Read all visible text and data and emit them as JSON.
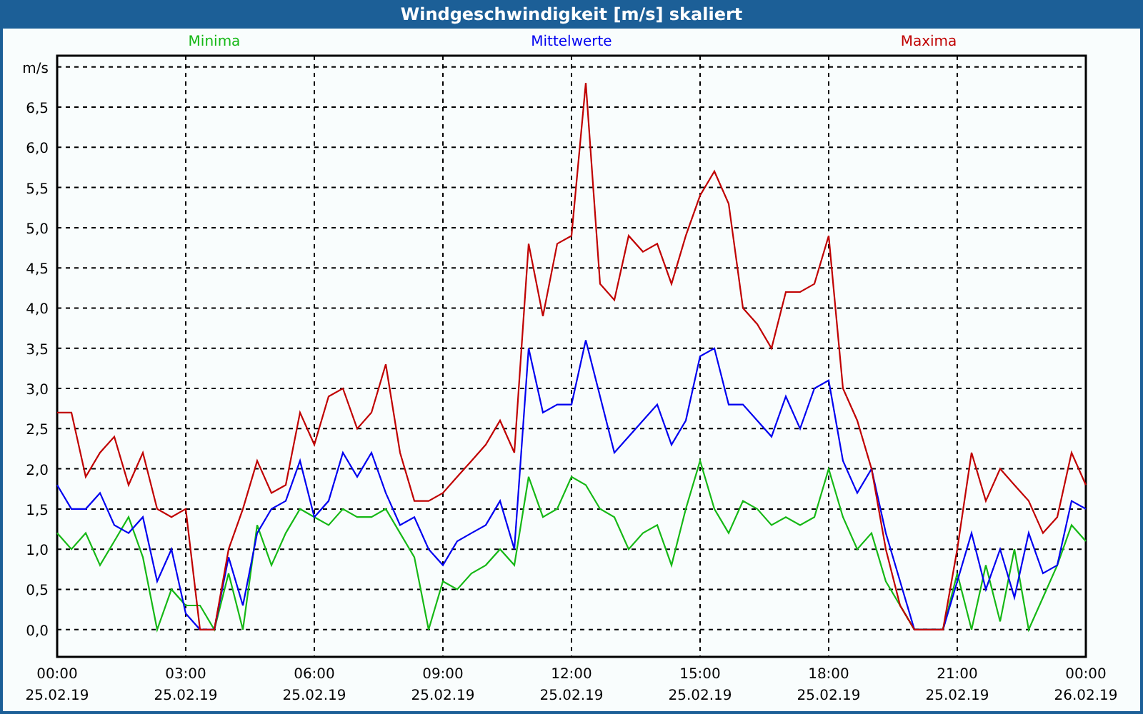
{
  "window": {
    "title": "Windgeschwindigkeit [m/s] skaliert"
  },
  "chart": {
    "chart_data": {
      "type": "line",
      "categories": [
        "00:00\n25.02.19",
        null,
        null,
        null,
        null,
        null,
        null,
        null,
        null,
        "03:00\n25.02.19",
        null,
        null,
        null,
        null,
        null,
        null,
        null,
        null,
        "06:00\n25.02.19",
        null,
        null,
        null,
        null,
        null,
        null,
        null,
        null,
        "09:00\n25.02.19",
        null,
        null,
        null,
        null,
        null,
        null,
        null,
        null,
        "12:00\n25.02.19",
        null,
        null,
        null,
        null,
        null,
        null,
        null,
        null,
        "15:00\n25.02.19",
        null,
        null,
        null,
        null,
        null,
        null,
        null,
        null,
        "18:00\n25.02.19",
        null,
        null,
        null,
        null,
        null,
        null,
        null,
        null,
        "21:00\n25.02.19",
        null,
        null,
        null,
        null,
        null,
        null,
        null,
        null,
        "00:00\n26.02.19"
      ],
      "series": [
        {
          "name": "Minima",
          "color": "#16b816",
          "values": [
            1.2,
            1.0,
            1.2,
            0.8,
            1.1,
            1.4,
            0.9,
            0.0,
            0.5,
            0.3,
            0.3,
            0.0,
            0.7,
            0.0,
            1.3,
            0.8,
            1.2,
            1.5,
            1.4,
            1.3,
            1.5,
            1.4,
            1.4,
            1.5,
            1.2,
            0.9,
            0.0,
            0.6,
            0.5,
            0.7,
            0.8,
            1.0,
            0.8,
            1.9,
            1.4,
            1.5,
            1.9,
            1.8,
            1.5,
            1.4,
            1.0,
            1.2,
            1.3,
            0.8,
            1.5,
            2.1,
            1.5,
            1.2,
            1.6,
            1.5,
            1.3,
            1.4,
            1.3,
            1.4,
            2.0,
            1.4,
            1.0,
            1.2,
            0.6,
            0.3,
            0.0,
            0.0,
            0.0,
            0.7,
            0.0,
            0.8,
            0.1,
            1.0,
            0.0,
            0.4,
            0.8,
            1.3,
            1.1
          ]
        },
        {
          "name": "Mittelwerte",
          "color": "#0000f0",
          "values": [
            1.8,
            1.5,
            1.5,
            1.7,
            1.3,
            1.2,
            1.4,
            0.6,
            1.0,
            0.2,
            0.0,
            0.0,
            0.9,
            0.3,
            1.2,
            1.5,
            1.6,
            2.1,
            1.4,
            1.6,
            2.2,
            1.9,
            2.2,
            1.7,
            1.3,
            1.4,
            1.0,
            0.8,
            1.1,
            1.2,
            1.3,
            1.6,
            1.0,
            3.5,
            2.7,
            2.8,
            2.8,
            3.6,
            2.9,
            2.2,
            2.4,
            2.6,
            2.8,
            2.3,
            2.6,
            3.4,
            3.5,
            2.8,
            2.8,
            2.6,
            2.4,
            2.9,
            2.5,
            3.0,
            3.1,
            2.1,
            1.7,
            2.0,
            1.2,
            0.6,
            0.0,
            0.0,
            0.0,
            0.6,
            1.2,
            0.5,
            1.0,
            0.4,
            1.2,
            0.7,
            0.8,
            1.6,
            1.5
          ]
        },
        {
          "name": "Maxima",
          "color": "#c00000",
          "values": [
            2.7,
            2.7,
            1.9,
            2.2,
            2.4,
            1.8,
            2.2,
            1.5,
            1.4,
            1.5,
            0.0,
            0.0,
            1.0,
            1.5,
            2.1,
            1.7,
            1.8,
            2.7,
            2.3,
            2.9,
            3.0,
            2.5,
            2.7,
            3.3,
            2.2,
            1.6,
            1.6,
            1.7,
            1.9,
            2.1,
            2.3,
            2.6,
            2.2,
            4.8,
            3.9,
            4.8,
            4.9,
            6.8,
            4.3,
            4.1,
            4.9,
            4.7,
            4.8,
            4.3,
            4.9,
            5.4,
            5.7,
            5.3,
            4.0,
            3.8,
            3.5,
            4.2,
            4.2,
            4.3,
            4.9,
            3.0,
            2.6,
            2.0,
            1.0,
            0.3,
            0.0,
            0.0,
            0.0,
            1.0,
            2.2,
            1.6,
            2.0,
            1.8,
            1.6,
            1.2,
            1.4,
            2.2,
            1.8
          ]
        }
      ],
      "ylim": [
        -0.34,
        7.14
      ],
      "grid": true,
      "yticks": [
        {
          "value": 0,
          "label": "0,0"
        },
        {
          "value": 0.5,
          "label": "0,5"
        },
        {
          "value": 1,
          "label": "1,0"
        },
        {
          "value": 1.5,
          "label": "1,5"
        },
        {
          "value": 2,
          "label": "2,0"
        },
        {
          "value": 2.5,
          "label": "2,5"
        },
        {
          "value": 3,
          "label": "3,0"
        },
        {
          "value": 3.5,
          "label": "3,5"
        },
        {
          "value": 4,
          "label": "4,0"
        },
        {
          "value": 4.5,
          "label": "4,5"
        },
        {
          "value": 5,
          "label": "5,0"
        },
        {
          "value": 5.5,
          "label": "5,5"
        },
        {
          "value": 6,
          "label": "6,0"
        },
        {
          "value": 6.5,
          "label": "6,5"
        },
        {
          "value": 7,
          "label": "m/s"
        }
      ]
    }
  }
}
